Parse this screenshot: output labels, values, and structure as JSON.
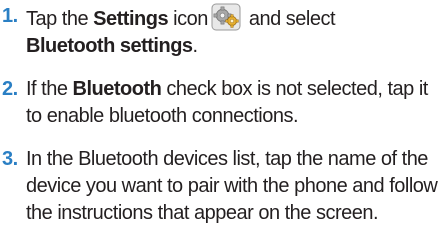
{
  "steps": [
    {
      "number": "1.",
      "seg1": "Tap the ",
      "bold1": "Settings",
      "seg2": " icon",
      "seg3": " and select",
      "bold2": "Bluetooth settings",
      "seg4": ".",
      "icon": "settings-gear-icon"
    },
    {
      "number": "2.",
      "seg1": "If the ",
      "bold1": "Bluetooth",
      "seg2": " check box is not selected, tap it to enable bluetooth connections."
    },
    {
      "number": "3.",
      "text": "In the Bluetooth devices list, tap the name of the device you want to pair with the phone and follow the instructions that appear on the screen."
    }
  ],
  "colors": {
    "step_number": "#2a7fc4",
    "text": "#231f20",
    "icon_gear": "#b8b8b8",
    "icon_accent": "#e0a020"
  }
}
